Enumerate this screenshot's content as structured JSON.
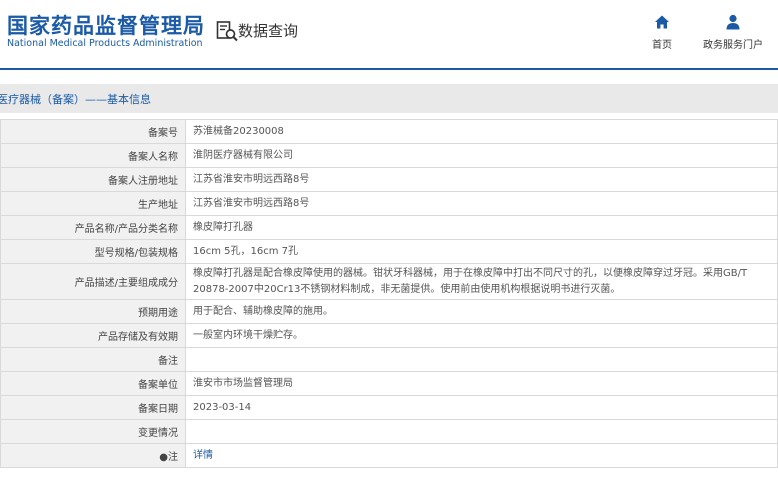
{
  "header": {
    "logo_cn": "国家药品监督管理局",
    "logo_en": "National Medical Products Administration",
    "query_label": "数据查询",
    "nav": [
      {
        "label": "首页",
        "icon": "home-icon"
      },
      {
        "label": "政务服务门户",
        "icon": "user-icon"
      }
    ]
  },
  "breadcrumb": "医疗器械（备案）——基本信息",
  "records": [
    {
      "label": "备案号",
      "value": "苏淮械备20230008"
    },
    {
      "label": "备案人名称",
      "value": "淮阴医疗器械有限公司"
    },
    {
      "label": "备案人注册地址",
      "value": "江苏省淮安市明远西路8号"
    },
    {
      "label": "生产地址",
      "value": "江苏省淮安市明远西路8号"
    },
    {
      "label": "产品名称/产品分类名称",
      "value": "橡皮障打孔器"
    },
    {
      "label": "型号规格/包装规格",
      "value": "16cm 5孔，16cm 7孔"
    },
    {
      "label": "产品描述/主要组成成分",
      "value": "橡皮障打孔器是配合橡皮障使用的器械。钳状牙科器械，用于在橡皮障中打出不同尺寸的孔，以便橡皮障穿过牙冠。采用GB/T 20878-2007中20Cr13不锈钢材料制成，非无菌提供。使用前由使用机构根据说明书进行灭菌。"
    },
    {
      "label": "预期用途",
      "value": "用于配合、辅助橡皮障的施用。"
    },
    {
      "label": "产品存储及有效期",
      "value": "一般室内环境干燥贮存。"
    },
    {
      "label": "备注",
      "value": ""
    },
    {
      "label": "备案单位",
      "value": "淮安市市场监督管理局"
    },
    {
      "label": "备案日期",
      "value": "2023-03-14"
    },
    {
      "label": "变更情况",
      "value": ""
    }
  ],
  "note": {
    "label": "●注",
    "link": "详情"
  },
  "colors": {
    "brand": "#1a5aa6",
    "label_bg": "#f1f1f1",
    "border": "#d9d9d9",
    "breadcrumb_bg": "#e9e9e9"
  }
}
